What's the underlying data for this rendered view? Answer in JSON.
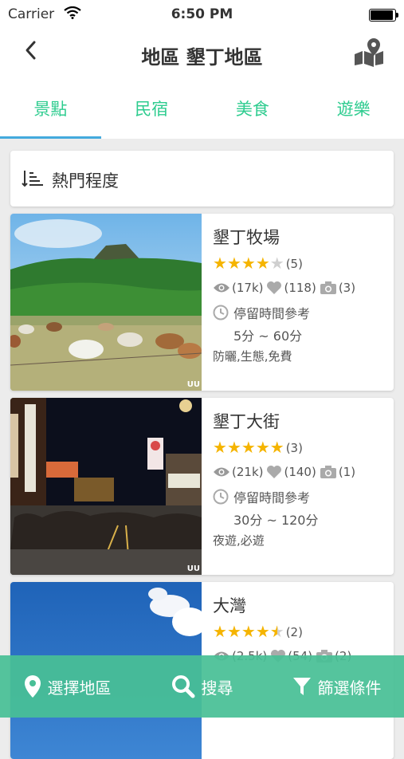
{
  "status_bar": {
    "carrier": "Carrier",
    "time": "6:50 PM",
    "battery_level": 1.0
  },
  "nav": {
    "title": "地區 墾丁地區",
    "back_icon": "chevron-left-icon",
    "map_icon": "map-pin-icon"
  },
  "tabs": [
    {
      "label": "景點",
      "active": true
    },
    {
      "label": "民宿",
      "active": false
    },
    {
      "label": "美食",
      "active": false
    },
    {
      "label": "遊樂",
      "active": false
    }
  ],
  "sort": {
    "label": "熱門程度",
    "icon": "sort-icon"
  },
  "places": [
    {
      "name": "墾丁牧場",
      "rating": 4,
      "rating_count": "(5)",
      "views": "(17k)",
      "likes": "(118)",
      "photos": "(3)",
      "stay_label": "停留時間參考",
      "stay_range": "5分 ~ 60分",
      "tags": "防曬,生態,免費",
      "watermark": "UU"
    },
    {
      "name": "墾丁大街",
      "rating": 5,
      "rating_count": "(3)",
      "views": "(21k)",
      "likes": "(140)",
      "photos": "(1)",
      "stay_label": "停留時間參考",
      "stay_range": "30分 ~ 120分",
      "tags": "夜遊,必遊",
      "watermark": "UU"
    },
    {
      "name": "大灣",
      "rating": 4.5,
      "rating_count": "(2)",
      "views": "(2.5k)",
      "likes": "(54)",
      "photos": "(2)"
    }
  ],
  "bottom_bar": [
    {
      "label": "選擇地區",
      "icon": "location-pin-icon"
    },
    {
      "label": "搜尋",
      "icon": "search-icon"
    },
    {
      "label": "篩選條件",
      "icon": "filter-icon"
    }
  ],
  "colors": {
    "accent": "#2ecc8f",
    "tab_indicator": "#44aadd",
    "star": "#f5b400",
    "bottom_bar": "#48bf96"
  }
}
